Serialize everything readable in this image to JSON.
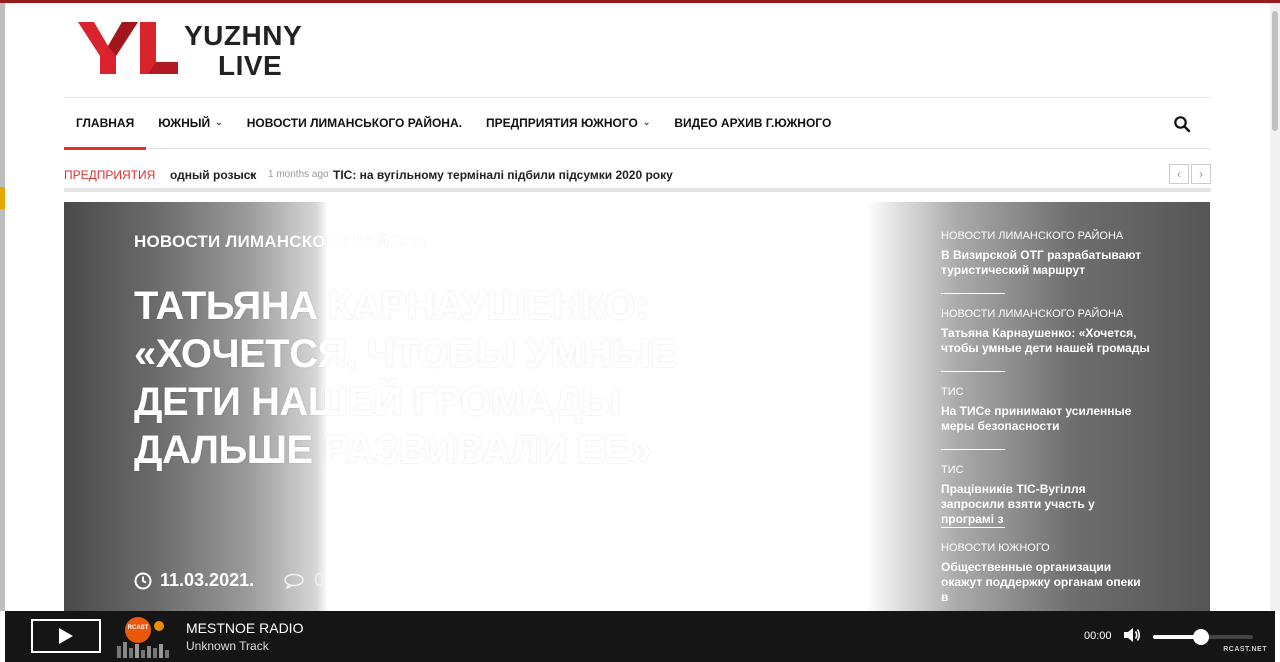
{
  "site": {
    "logo_mark": "YL",
    "logo_line1": "YUZHNY",
    "logo_line2": "LIVE",
    "brand_red": "#d9232d"
  },
  "nav": {
    "items": [
      {
        "label": "ГЛАВНАЯ",
        "active": true,
        "dropdown": false
      },
      {
        "label": "ЮЖНЫЙ",
        "active": false,
        "dropdown": true
      },
      {
        "label": "НОВОСТИ ЛИМАНСЬКОГО РАЙОНА.",
        "active": false,
        "dropdown": false
      },
      {
        "label": "ПРЕДПРИЯТИЯ ЮЖНОГО",
        "active": false,
        "dropdown": true
      },
      {
        "label": "ВИДЕО АРХИВ Г.ЮЖНОГО",
        "active": false,
        "dropdown": false
      }
    ],
    "search_icon": "search-icon"
  },
  "ticker": {
    "label": "ПРЕДПРИЯТИЯ",
    "item1": "одный розыск",
    "separator": "•",
    "time": "1 months ago",
    "item2": "ТІС: на вугільному терміналі підбили підсумки 2020 року",
    "prev": "‹",
    "next": "›"
  },
  "hero": {
    "category": "НОВОСТИ ЛИМАНСКОГО РАЙОНА",
    "headline": "ТАТЬЯНА КАРНАУШЕНКО: «ХОЧЕТСЯ, ЧТОБЫ УМНЫЕ ДЕТИ НАШЕЙ ГРОМАДЫ ДАЛЬШЕ РАЗВИВАЛИ ЕЕ»",
    "date": "11.03.2021.",
    "comments": "0"
  },
  "sidebar": {
    "items": [
      {
        "category": "НОВОСТИ ЛИМАНСКОГО РАЙОНА",
        "title": "В Визирской ОТГ разрабатывают туристический маршрут"
      },
      {
        "category": "НОВОСТИ ЛИМАНСКОГО РАЙОНА",
        "title": "Татьяна Карнаушенко: «Хочется, чтобы умные дети нашей громады"
      },
      {
        "category": "ТИС",
        "title": "На ТИСе принимают усиленные меры безопасности"
      },
      {
        "category": "ТИС",
        "title": "Працівників ТІС-Вугілля запросили взяти участь у програмі з"
      },
      {
        "category": "НОВОСТИ ЮЖНОГО",
        "title": "Общественные организации окажут поддержку органам опеки в"
      }
    ]
  },
  "player": {
    "station": "MESTNOE RADIO",
    "track": "Unknown Track",
    "time": "00:00",
    "volume_percent": 48,
    "brand": "RCAST.NET",
    "cover_text": "RCAST"
  }
}
